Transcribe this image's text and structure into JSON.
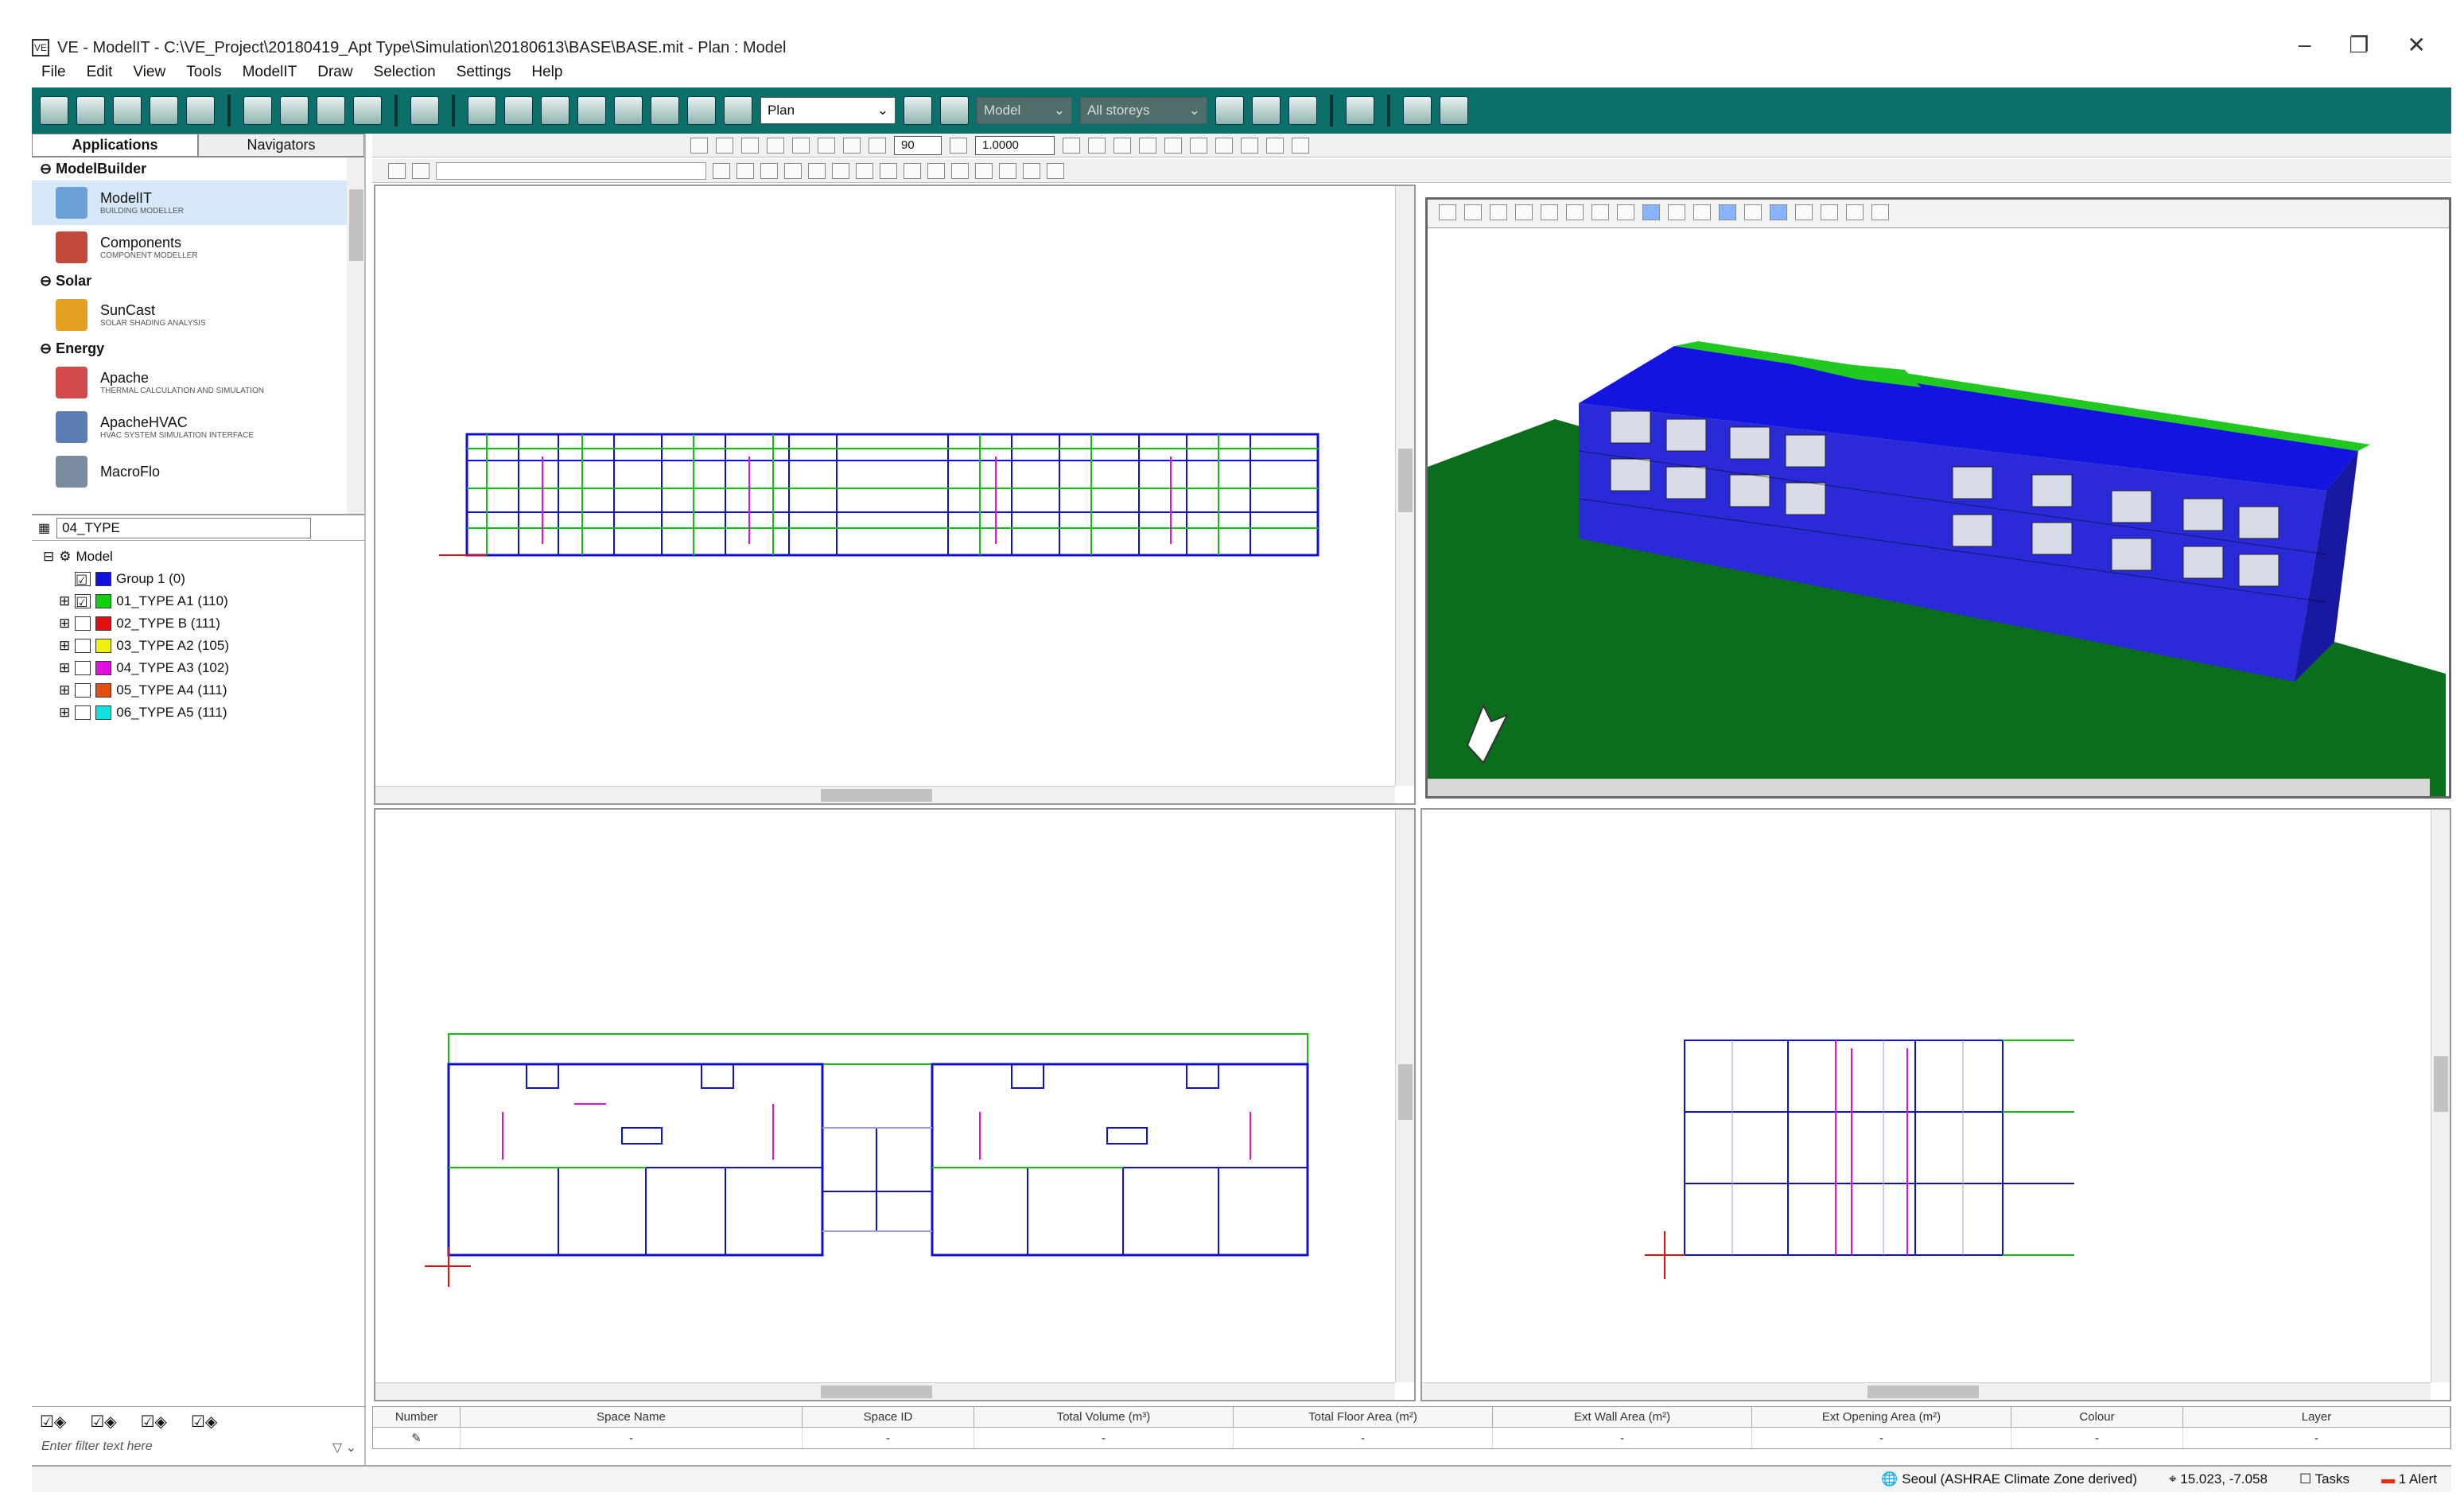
{
  "title": "VE - ModelIT - C:\\VE_Project\\20180419_Apt Type\\Simulation\\20180613\\BASE\\BASE.mit - Plan : Model",
  "menu": [
    "File",
    "Edit",
    "View",
    "Tools",
    "ModelIT",
    "Draw",
    "Selection",
    "Settings",
    "Help"
  ],
  "toolbar": {
    "view": "Plan",
    "layer": "Model",
    "storey": "All storeys"
  },
  "zoom_fields": {
    "angle": "90",
    "scale": "1.0000"
  },
  "sidebar": {
    "tab_apps": "Applications",
    "tab_navigators": "Navigators",
    "categories": [
      {
        "name": "ModelBuilder",
        "items": [
          {
            "label": "ModelIT",
            "sub": "BUILDING MODELLER",
            "color": "#6aa1d6"
          },
          {
            "label": "Components",
            "sub": "COMPONENT MODELLER",
            "color": "#c34a3a"
          }
        ]
      },
      {
        "name": "Solar",
        "items": [
          {
            "label": "SunCast",
            "sub": "SOLAR SHADING ANALYSIS",
            "color": "#e3a022"
          }
        ]
      },
      {
        "name": "Energy",
        "items": [
          {
            "label": "Apache",
            "sub": "THERMAL CALCULATION AND SIMULATION",
            "color": "#d24b4b"
          },
          {
            "label": "ApacheHVAC",
            "sub": "HVAC SYSTEM SIMULATION INTERFACE",
            "color": "#5b7fb3"
          },
          {
            "label": "MacroFlo",
            "sub": "",
            "color": "#7a8aa0"
          }
        ]
      }
    ],
    "group_select": "04_TYPE",
    "tree_root": "Model",
    "groups": [
      {
        "label": "Group 1 (0)",
        "color": "#1010e0"
      },
      {
        "label": "01_TYPE A1 (110)",
        "color": "#10d010"
      },
      {
        "label": "02_TYPE B (111)",
        "color": "#e01010"
      },
      {
        "label": "03_TYPE A2 (105)",
        "color": "#f0f010"
      },
      {
        "label": "04_TYPE A3 (102)",
        "color": "#e010e0"
      },
      {
        "label": "05_TYPE A4 (111)",
        "color": "#e05010"
      },
      {
        "label": "06_TYPE A5 (111)",
        "color": "#10e0e0"
      }
    ],
    "filter_placeholder": "Enter filter text here"
  },
  "table": {
    "columns": [
      "Number",
      "Space Name",
      "Space ID",
      "Total Volume (m³)",
      "Total Floor Area (m²)",
      "Ext Wall Area (m²)",
      "Ext Opening Area (m²)",
      "Colour",
      "Layer"
    ],
    "row": [
      "",
      "-",
      "-",
      "-",
      "-",
      "-",
      "-",
      "-",
      "-"
    ]
  },
  "status": {
    "location": "Seoul (ASHRAE Climate Zone derived)",
    "coords": "15.023, -7.058",
    "tasks": "Tasks",
    "alerts": "1 Alert"
  }
}
